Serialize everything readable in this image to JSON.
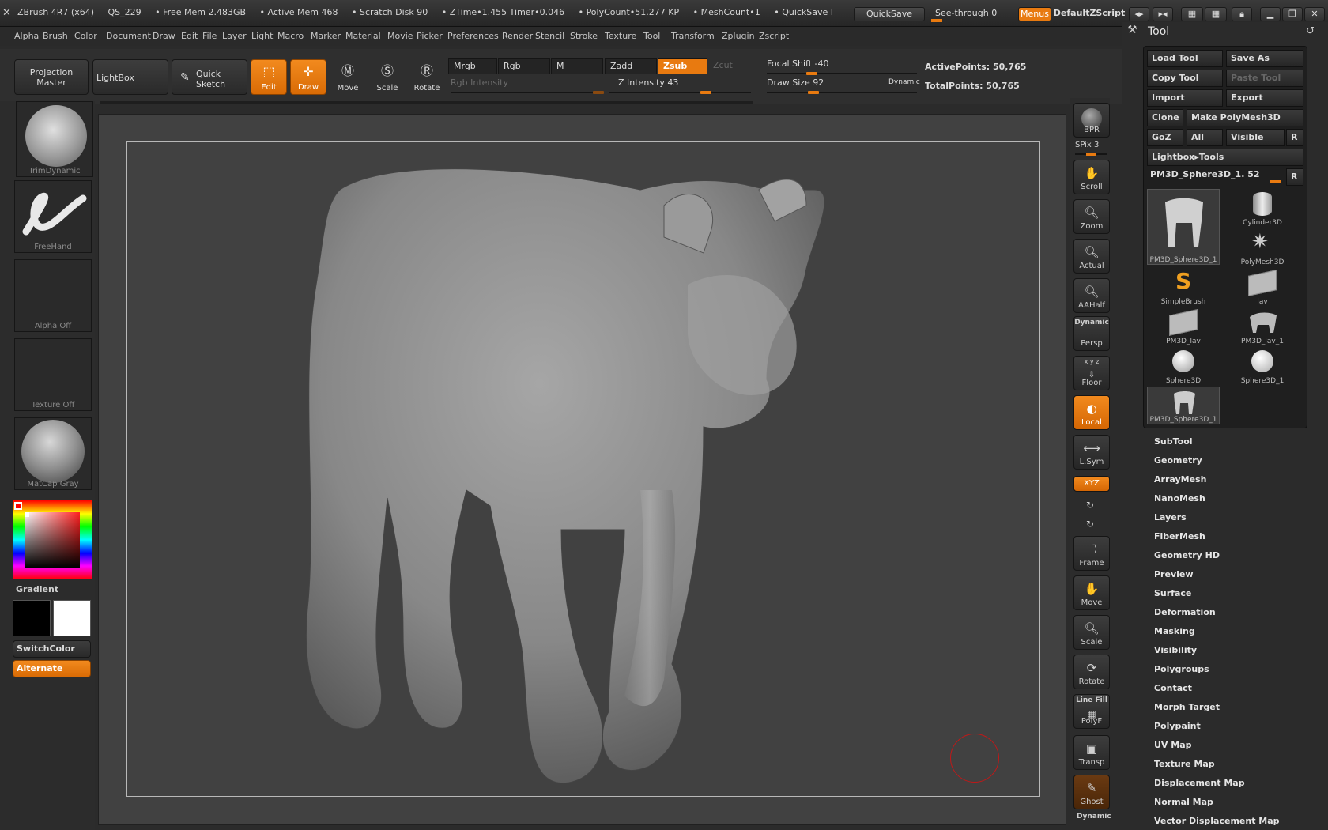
{
  "titlebar": {
    "app": "ZBrush 4R7 (x64)",
    "qs": "QS_229",
    "free_mem": "• Free Mem 2.483GB",
    "active_mem": "• Active Mem 468",
    "scratch": "• Scratch Disk 90",
    "ztime": "• ZTime•1.455 Timer•0.046",
    "polycount": "• PolyCount•51.277 KP",
    "meshcount": "• MeshCount•1",
    "quicksave_info": "• QuickSave I",
    "quicksave_btn": "QuickSave",
    "see_through": "See-through   0",
    "menus": "Menus",
    "script": "DefaultZScript"
  },
  "menu": [
    "Alpha",
    "Brush",
    "Color",
    "Document",
    "Draw",
    "Edit",
    "File",
    "Layer",
    "Light",
    "Macro",
    "Marker",
    "Material",
    "Movie",
    "Picker",
    "Preferences",
    "Render",
    "Stencil",
    "Stroke",
    "Texture",
    "Tool",
    "Transform",
    "Zplugin",
    "Zscript"
  ],
  "shelf": {
    "projection": "Projection Master",
    "lightbox": "LightBox",
    "quick_sketch": "Quick Sketch",
    "edit": "Edit",
    "draw": "Draw",
    "move": "Move",
    "scale": "Scale",
    "rotate": "Rotate",
    "mrgb": "Mrgb",
    "rgb": "Rgb",
    "m": "M",
    "rgb_intensity": "Rgb Intensity",
    "zadd": "Zadd",
    "zsub": "Zsub",
    "zcut": "Zcut",
    "z_intensity": "Z Intensity 43",
    "focal_shift": "Focal Shift -40",
    "draw_size": "Draw Size 92",
    "dynamic": "Dynamic",
    "active_points": "ActivePoints: 50,765",
    "total_points": "TotalPoints: 50,765"
  },
  "left": {
    "brush": "TrimDynamic",
    "stroke": "FreeHand",
    "alpha": "Alpha  Off",
    "texture": "Texture  Off",
    "material": "MatCap  Gray",
    "gradient": "Gradient",
    "switch_color": "SwitchColor",
    "alternate": "Alternate"
  },
  "right": {
    "bpr": "BPR",
    "spix": "SPix 3",
    "scroll": "Scroll",
    "zoom": "Zoom",
    "actual": "Actual",
    "aahalf": "AAHalf",
    "dynamic": "Dynamic",
    "persp": "Persp",
    "xyz_small": "x y z",
    "floor": "Floor",
    "local": "Local",
    "lsym": "L.Sym",
    "xyz": "XYZ",
    "frame": "Frame",
    "move": "Move",
    "scale": "Scale",
    "rotate": "Rotate",
    "linefill": "Line Fill",
    "polyf": "PolyF",
    "transp": "Transp",
    "ghost": "Ghost",
    "dynamic2": "Dynamic"
  },
  "tool": {
    "title": "Tool",
    "load": "Load Tool",
    "save_as": "Save As",
    "copy": "Copy Tool",
    "paste": "Paste Tool",
    "import": "Import",
    "export": "Export",
    "clone": "Clone",
    "make_poly": "Make PolyMesh3D",
    "goz": "GoZ",
    "all": "All",
    "visible": "Visible",
    "r": "R",
    "lightbox_tools": "Lightbox▸Tools",
    "current": "PM3D_Sphere3D_1. 52",
    "items": [
      "PM3D_Sphere3D_1",
      "Cylinder3D",
      "PolyMesh3D",
      "SimpleBrush",
      "lav",
      "PM3D_lav",
      "PM3D_lav_1",
      "Sphere3D",
      "Sphere3D_1",
      "PM3D_Sphere3D_1"
    ],
    "sections": [
      "SubTool",
      "Geometry",
      "ArrayMesh",
      "NanoMesh",
      "Layers",
      "FiberMesh",
      "Geometry HD",
      "Preview",
      "Surface",
      "Deformation",
      "Masking",
      "Visibility",
      "Polygroups",
      "Contact",
      "Morph Target",
      "Polypaint",
      "UV Map",
      "Texture Map",
      "Displacement Map",
      "Normal Map",
      "Vector Displacement Map"
    ]
  },
  "colors": {
    "accent": "#e87a10",
    "bg": "#2b2b2b",
    "viewport": "#414141"
  }
}
